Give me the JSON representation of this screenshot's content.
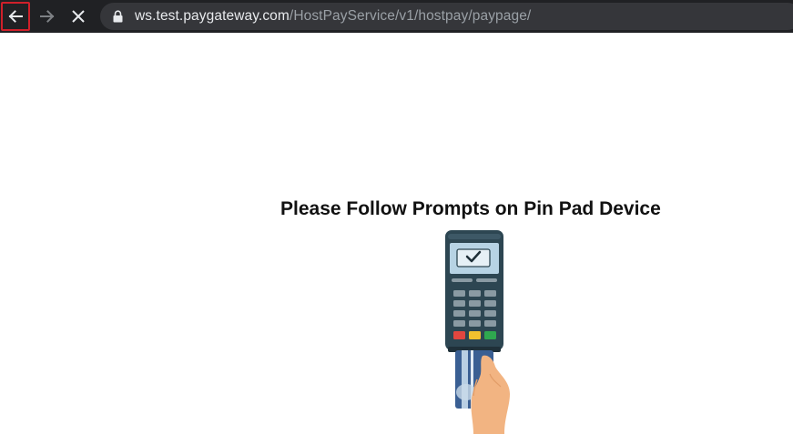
{
  "browser": {
    "url_host": "ws.test.paygateway.com",
    "url_path": "/HostPayService/v1/hostpay/paypage/",
    "icons": {
      "back": "back-arrow-icon",
      "forward": "forward-arrow-icon",
      "stop": "stop-loading-icon",
      "secure": "lock-icon"
    }
  },
  "page": {
    "prompt": "Please Follow Prompts on Pin Pad Device",
    "illustration": "pin-pad-device-illustration"
  },
  "colors": {
    "toolbar_bg": "#202124",
    "omnibox_bg": "#35363a",
    "highlight": "#d0202a",
    "device_body": "#2d4652",
    "card": "#3a5f93",
    "hand": "#f2b482"
  }
}
